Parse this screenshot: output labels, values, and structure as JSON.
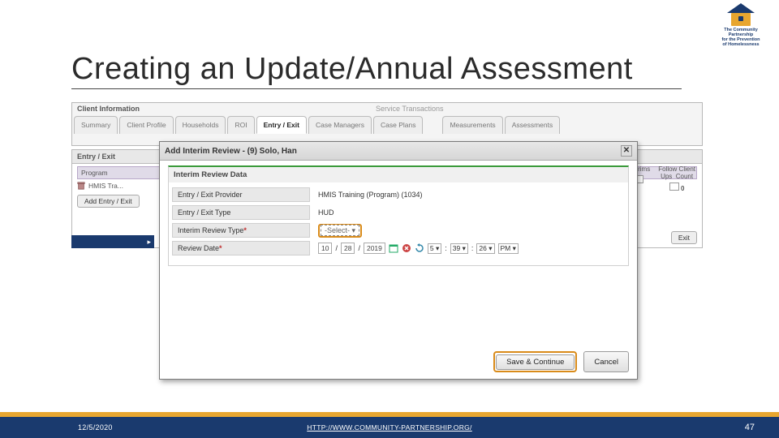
{
  "logo": {
    "line1": "The Community Partnership",
    "line2": "for the Prevention",
    "line3": "of Homelessness"
  },
  "title": "Creating an Update/Annual Assessment",
  "bgHeaders": {
    "clientInfo": "Client Information",
    "svcTrans": "Service Transactions"
  },
  "tabs": [
    "Summary",
    "Client Profile",
    "Households",
    "ROI",
    "Entry / Exit",
    "Case Managers",
    "Case Plans",
    "Measurements",
    "Assessments"
  ],
  "activeTabIndex": 4,
  "entryExit": {
    "panelTitle": "Entry / Exit",
    "programLabel": "Program",
    "interimsLabel": "Interims",
    "followLabel": "Follow Client\nUps   Count",
    "hmisRow": "HMIS Tra...",
    "addEntry": "Add Entry / Exit",
    "exitBtn": "Exit",
    "followCount": "0"
  },
  "modal": {
    "title": "Add Interim Review - (9) Solo, Han",
    "sectionTitle": "Interim Review Data",
    "rows": {
      "provider": {
        "label": "Entry / Exit Provider",
        "value": "HMIS Training (Program) (1034)"
      },
      "type": {
        "label": "Entry / Exit Type",
        "value": "HUD"
      },
      "reviewType": {
        "label": "Interim Review Type",
        "asterisk": "*",
        "selectPlaceholder": "-Select-"
      },
      "reviewDate": {
        "label": "Review Date",
        "asterisk": "*",
        "mm": "10",
        "dd": "28",
        "yyyy": "2019",
        "hour": "5",
        "min": "39",
        "sec": "26",
        "ampm": "PM"
      }
    },
    "saveBtn": "Save & Continue",
    "cancelBtn": "Cancel"
  },
  "footer": {
    "date": "12/5/2020",
    "url": "HTTP://WWW.COMMUNITY-PARTNERSHIP.ORG/",
    "page": "47"
  }
}
